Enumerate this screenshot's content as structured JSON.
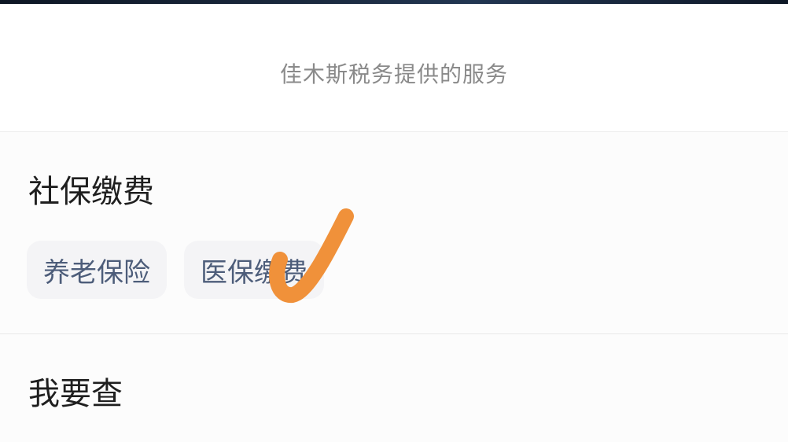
{
  "header": {
    "provider_text": "佳木斯税务提供的服务"
  },
  "social_security": {
    "title": "社保缴费",
    "chips": [
      {
        "label": "养老保险"
      },
      {
        "label": "医保缴费"
      }
    ]
  },
  "query": {
    "title": "我要查"
  },
  "annotation": {
    "icon": "check-mark-icon",
    "color": "#f0913a"
  }
}
